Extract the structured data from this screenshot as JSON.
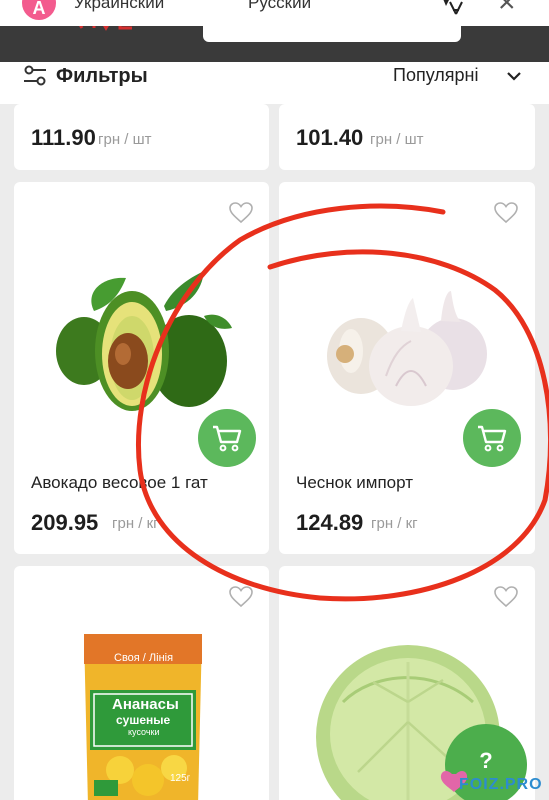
{
  "translate_bar": {
    "lang_source": "Украинский",
    "lang_target": "Русский"
  },
  "filters": {
    "label": "Фильтры",
    "sort": "Популярні"
  },
  "products": [
    {
      "price": "111.90",
      "unit": "грн / шт"
    },
    {
      "price": "101.40",
      "unit": "грн / шт"
    },
    {
      "name": "Авокадо весовое 1 гат",
      "price": "209.95",
      "unit": "грн / кг"
    },
    {
      "name": "Чеснок импорт",
      "price": "124.89",
      "unit": "грн / кг"
    },
    {
      "name": "",
      "price": "",
      "unit": ""
    },
    {
      "name": "",
      "price": "",
      "unit": ""
    }
  ],
  "package": {
    "brand": "Своя / Лінія",
    "title_line1": "Ананасы",
    "title_line2": "сушеные",
    "title_line3": "кусочки",
    "weight": "125г"
  },
  "help": {
    "symbol": "?"
  },
  "watermark": {
    "text": "FOIZ.PRO"
  },
  "colors": {
    "accent_green": "#5cb85c",
    "annotation_red": "#e8301c",
    "header_dark": "#3a3a3a"
  },
  "icons": {
    "filter": "sliders-icon",
    "sort": "chevron-down-icon",
    "favorite": "heart-outline-icon",
    "cart": "cart-icon",
    "translate": "translate-icon",
    "close": "close-icon"
  }
}
